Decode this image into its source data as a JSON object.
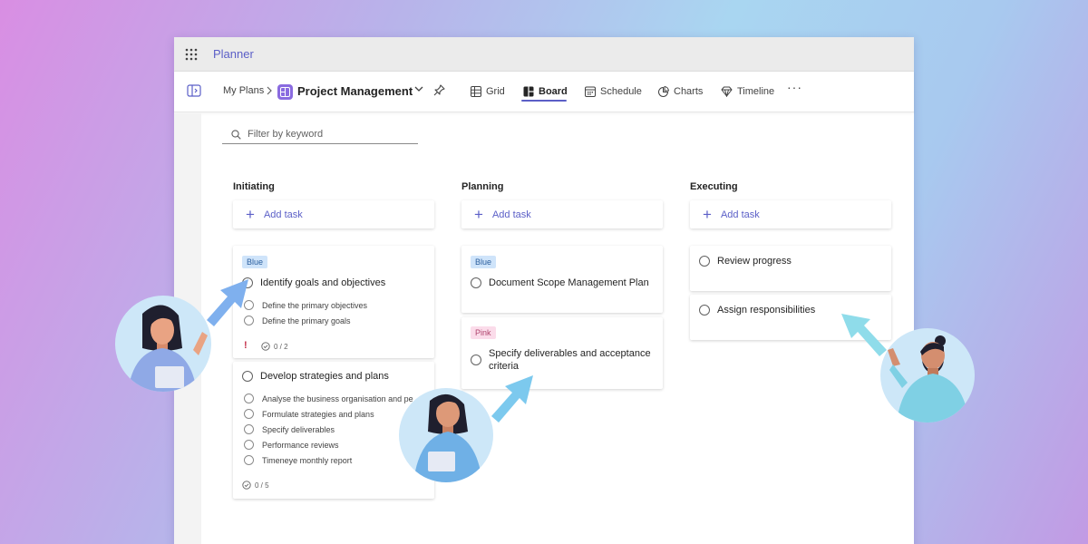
{
  "app": {
    "title": "Planner"
  },
  "toolbar": {
    "breadcrumb": "My Plans",
    "plan_name": "Project Management",
    "tabs": [
      {
        "label": "Grid",
        "icon": "grid-icon"
      },
      {
        "label": "Board",
        "icon": "board-icon",
        "active": true
      },
      {
        "label": "Schedule",
        "icon": "calendar-icon"
      },
      {
        "label": "Charts",
        "icon": "chart-icon"
      },
      {
        "label": "Timeline",
        "icon": "timeline-icon"
      }
    ],
    "more": "···"
  },
  "filter": {
    "placeholder": "Filter by keyword"
  },
  "board": {
    "columns": [
      {
        "title": "Initiating",
        "add_task": "Add task",
        "cards": [
          {
            "label": "Blue",
            "title": "Identify goals and objectives",
            "subtasks": [
              "Define the primary objectives",
              "Define the primary goals"
            ],
            "priority": "!",
            "progress": "0 / 2"
          },
          {
            "title": "Develop strategies and plans",
            "subtasks": [
              "Analyse the business organisation and pe",
              "Formulate strategies and plans",
              "Specify deliverables",
              "Performance reviews",
              "Timeneye monthly report"
            ],
            "progress": "0 / 5"
          }
        ]
      },
      {
        "title": "Planning",
        "add_task": "Add task",
        "cards": [
          {
            "label": "Blue",
            "title": "Document Scope Management Plan"
          },
          {
            "label": "Pink",
            "title": "Specify deliverables and acceptance criteria"
          }
        ]
      },
      {
        "title": "Executing",
        "add_task": "Add task",
        "cards": [
          {
            "title": "Review progress"
          },
          {
            "title": "Assign responsibilities"
          }
        ]
      }
    ]
  },
  "colors": {
    "accent": "#5b5fc7",
    "label_blue": "#cfe4fa",
    "label_pink": "#fbdcea",
    "priority": "#c4314b",
    "arrow_blue": "#7fb0ee",
    "arrow_sky": "#7cc9ee",
    "arrow_cyan": "#8fdcea"
  }
}
